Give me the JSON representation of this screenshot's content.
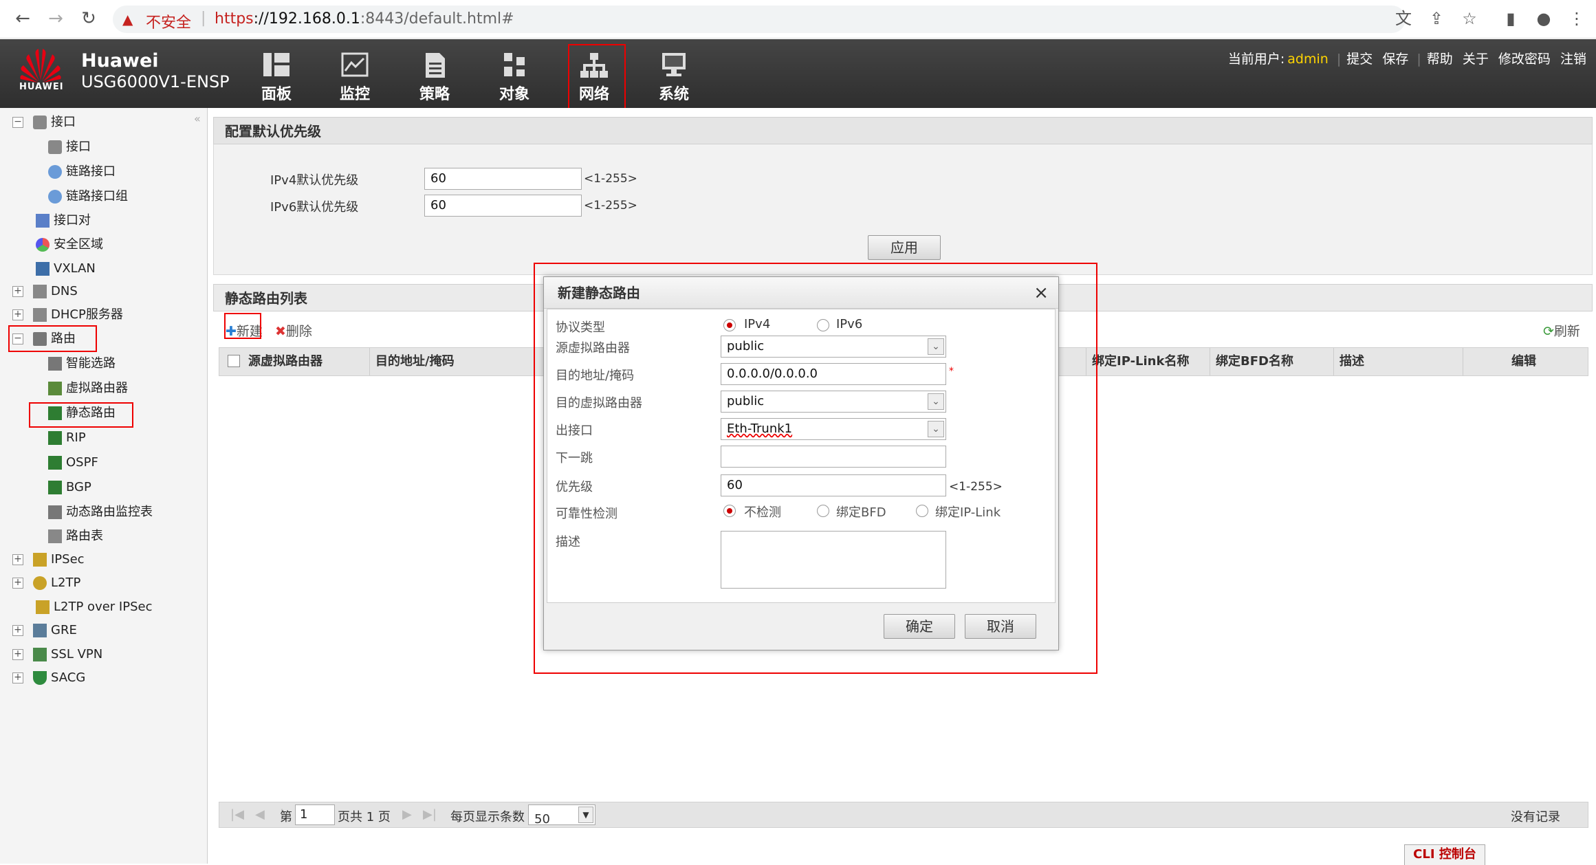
{
  "browser": {
    "insecure_label": "不安全",
    "url_proto": "https",
    "url_host": "://192.168.0.1",
    "url_rest": ":8443/default.html#"
  },
  "header": {
    "logo_text": "HUAWEI",
    "brand": "Huawei",
    "model": "USG6000V1-ENSP",
    "nav": [
      {
        "label": "面板",
        "icon": "dashboard-icon"
      },
      {
        "label": "监控",
        "icon": "monitor-icon"
      },
      {
        "label": "策略",
        "icon": "policy-icon"
      },
      {
        "label": "对象",
        "icon": "object-icon"
      },
      {
        "label": "网络",
        "icon": "network-icon"
      },
      {
        "label": "系统",
        "icon": "system-icon"
      }
    ],
    "current_user_label": "当前用户:",
    "current_user": "admin",
    "links": [
      "提交",
      "保存",
      "帮助",
      "关于",
      "修改密码",
      "注销"
    ]
  },
  "sidebar": {
    "items": [
      {
        "label": "接口"
      },
      {
        "label": "接口"
      },
      {
        "label": "链路接口"
      },
      {
        "label": "链路接口组"
      },
      {
        "label": "接口对"
      },
      {
        "label": "安全区域"
      },
      {
        "label": "VXLAN"
      },
      {
        "label": "DNS"
      },
      {
        "label": "DHCP服务器"
      },
      {
        "label": "路由"
      },
      {
        "label": "智能选路"
      },
      {
        "label": "虚拟路由器"
      },
      {
        "label": "静态路由"
      },
      {
        "label": "RIP"
      },
      {
        "label": "OSPF"
      },
      {
        "label": "BGP"
      },
      {
        "label": "动态路由监控表"
      },
      {
        "label": "路由表"
      },
      {
        "label": "IPSec"
      },
      {
        "label": "L2TP"
      },
      {
        "label": "L2TP over IPSec"
      },
      {
        "label": "GRE"
      },
      {
        "label": "SSL VPN"
      },
      {
        "label": "SACG"
      }
    ]
  },
  "priority_panel": {
    "title": "配置默认优先级",
    "ipv4_label": "IPv4默认优先级",
    "ipv4_value": "60",
    "ipv6_label": "IPv6默认优先级",
    "ipv6_value": "60",
    "range": "<1-255>",
    "apply": "应用"
  },
  "routes_panel": {
    "title": "静态路由列表",
    "new": "新建",
    "delete": "删除",
    "refresh": "刷新",
    "columns": [
      "源虚拟路由器",
      "目的地址/掩码",
      "绑定IP-Link名称",
      "绑定BFD名称",
      "描述",
      "编辑"
    ]
  },
  "pager": {
    "page_prefix": "第",
    "page_value": "1",
    "page_suffix": "页共 1 页",
    "per_page_label": "每页显示条数",
    "per_page_value": "50",
    "no_records": "没有记录"
  },
  "cli": "CLI 控制台",
  "modal": {
    "title": "新建静态路由",
    "protocol_label": "协议类型",
    "ipv4": "IPv4",
    "ipv6": "IPv6",
    "src_vr_label": "源虚拟路由器",
    "src_vr_value": "public",
    "dest_label": "目的地址/掩码",
    "dest_value": "0.0.0.0/0.0.0.0",
    "required_mark": "*",
    "dst_vr_label": "目的虚拟路由器",
    "dst_vr_value": "public",
    "out_if_label": "出接口",
    "out_if_value": "Eth-Trunk1",
    "next_hop_label": "下一跳",
    "next_hop_value": "",
    "priority_label": "优先级",
    "priority_value": "60",
    "priority_range": "<1-255>",
    "reliability_label": "可靠性检测",
    "opt_none": "不检测",
    "opt_bfd": "绑定BFD",
    "opt_iplink": "绑定IP-Link",
    "desc_label": "描述",
    "ok": "确定",
    "cancel": "取消"
  }
}
